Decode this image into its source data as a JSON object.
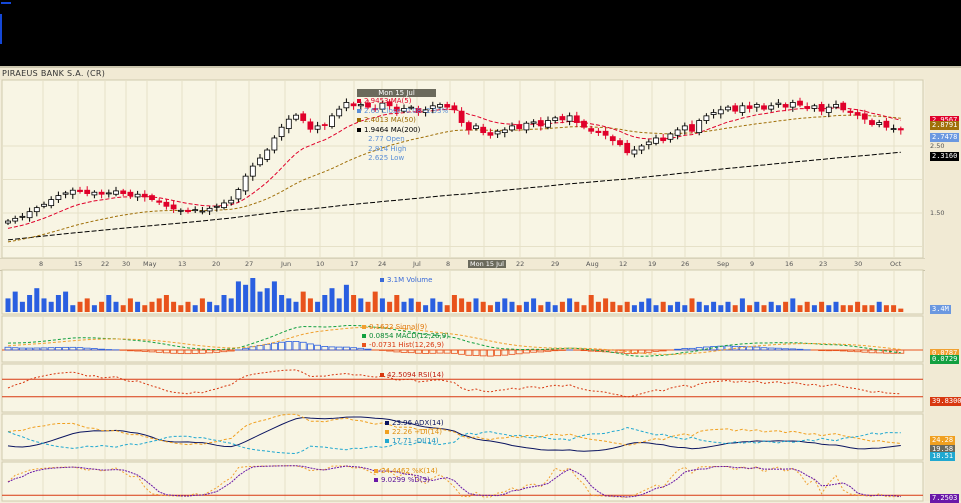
{
  "window": {
    "title": "PIRAEUS BANK S.A. (CR)"
  },
  "tooltip": {
    "date": "Mon 15 Jul",
    "rows": [
      {
        "text": "2.9453 MA(5)",
        "color": "#e0002a"
      },
      {
        "text": "2.65 Close  -0.08 -2.93%",
        "color": "#5b8fd6"
      },
      {
        "text": "2.4013 MA(50)",
        "color": "#9a6a00"
      },
      {
        "text": "1.9464 MA(200)",
        "color": "#000000"
      },
      {
        "text": "2.77 Open",
        "color": "#5b8fd6"
      },
      {
        "text": "2.814 High",
        "color": "#5b8fd6"
      },
      {
        "text": "2.625 Low",
        "color": "#5b8fd6"
      }
    ]
  },
  "colors": {
    "up": "#ffffff",
    "down": "#e0002a",
    "ma_fast": "#e0002a",
    "ma_mid": "#a0700a",
    "ma_slow": "#000000",
    "vol_up": "#2a5fe0",
    "vol_down": "#e8531c",
    "macd": "#12a040",
    "signal": "#f0a030",
    "hist": "#e8531c",
    "rsi": "#d83810",
    "adx": "#0a1460",
    "pdi": "#f0a020",
    "mdi": "#20a8d0",
    "k": "#f0a030",
    "d": "#6a18a8",
    "bg": "#f8f5e4",
    "grid": "#e6e1c8"
  },
  "chart_data": {
    "type": "candlestick",
    "title": "PIRAEUS BANK S.A. (CR)",
    "x_tick_labels": [
      "8",
      "15",
      "22",
      "30",
      "May",
      "13",
      "20",
      "27",
      "Jun",
      "10",
      "17",
      "24",
      "Jul",
      "8",
      "Mon 15 Jul",
      "22",
      "29",
      "Aug",
      "12",
      "19",
      "26",
      "Sep",
      "9",
      "16",
      "23",
      "30",
      "Oct"
    ],
    "y_tick_labels": [
      "2.50",
      "1.50"
    ],
    "y_tick_values": [
      2.5,
      1.5
    ],
    "ylim": [
      0.95,
      3.3
    ],
    "close": [
      1.38,
      1.42,
      1.45,
      1.52,
      1.58,
      1.63,
      1.7,
      1.76,
      1.8,
      1.84,
      1.82,
      1.79,
      1.81,
      1.78,
      1.8,
      1.83,
      1.79,
      1.76,
      1.78,
      1.74,
      1.7,
      1.66,
      1.6,
      1.56,
      1.54,
      1.52,
      1.55,
      1.53,
      1.57,
      1.6,
      1.65,
      1.69,
      1.85,
      2.05,
      2.2,
      2.32,
      2.44,
      2.62,
      2.78,
      2.9,
      2.96,
      2.88,
      2.75,
      2.8,
      2.81,
      2.95,
      3.05,
      3.15,
      3.1,
      3.12,
      3.08,
      3.05,
      3.14,
      3.1,
      3.02,
      3.06,
      3.08,
      3.0,
      3.04,
      3.1,
      3.12,
      3.08,
      3.04,
      2.85,
      2.74,
      2.8,
      2.7,
      2.66,
      2.72,
      2.74,
      2.8,
      2.76,
      2.84,
      2.86,
      2.8,
      2.88,
      2.92,
      2.89,
      2.95,
      2.85,
      2.78,
      2.72,
      2.7,
      2.66,
      2.58,
      2.52,
      2.4,
      2.44,
      2.5,
      2.56,
      2.62,
      2.58,
      2.68,
      2.74,
      2.8,
      2.72,
      2.88,
      2.95,
      3.0,
      3.04,
      3.08,
      3.02,
      3.1,
      3.06,
      3.12,
      3.05,
      3.1,
      3.14,
      3.08,
      3.15,
      3.11,
      3.06,
      3.1,
      3.02,
      3.08,
      3.12,
      3.04,
      3.0,
      2.96,
      2.9,
      2.82,
      2.85,
      2.78,
      2.76,
      2.74
    ],
    "volume": [
      4,
      6,
      3,
      5,
      7,
      4,
      3,
      5,
      6,
      2,
      3,
      4,
      2,
      3,
      5,
      3,
      2,
      4,
      3,
      2,
      3,
      4,
      5,
      3,
      2,
      3,
      2,
      4,
      3,
      2,
      5,
      4,
      9,
      8,
      10,
      6,
      7,
      9,
      5,
      4,
      3,
      6,
      4,
      3,
      5,
      7,
      4,
      8,
      5,
      4,
      3,
      6,
      4,
      3,
      5,
      3,
      4,
      3,
      2,
      4,
      3,
      2,
      5,
      4,
      3,
      4,
      3,
      2,
      3,
      4,
      3,
      2,
      3,
      4,
      2,
      3,
      2,
      3,
      4,
      3,
      2,
      5,
      3,
      4,
      3,
      2,
      3,
      2,
      3,
      4,
      2,
      3,
      2,
      3,
      2,
      4,
      3,
      2,
      3,
      2,
      3,
      2,
      4,
      2,
      3,
      2,
      3,
      2,
      3,
      4,
      2,
      3,
      2,
      3,
      2,
      3,
      2,
      2,
      3,
      2,
      2,
      3,
      2,
      2,
      1
    ],
    "right_labels": {
      "ma_fast": "2.9567",
      "ma_mid": "2.8791",
      "close": "2.7478",
      "ma_slow": "2.3160",
      "volume": "3.4M",
      "signal": "0.0787",
      "macd": "0.0729",
      "rsi": "39.8300",
      "pdi": "24.28",
      "adx": "19.58",
      "mdi": "18.51",
      "stoch": "7.2503"
    }
  },
  "panels": {
    "volume": {
      "legend": "3.1M Volume"
    },
    "macd": {
      "legend": [
        "0.1622 Signal(9)",
        "0.0854 MACD(12,26,9)",
        "-0.0731 Hist(12,26,9)"
      ]
    },
    "rsi": {
      "legend": "42.5094 RSI(14)"
    },
    "adx": {
      "legend": [
        "23.96 ADX(14)",
        "22.26 +DI(14)",
        "17.71 -DI(14)"
      ]
    },
    "stoch": {
      "legend": [
        "24.4462 %K(14)",
        "9.0299 %D(3)"
      ]
    }
  }
}
